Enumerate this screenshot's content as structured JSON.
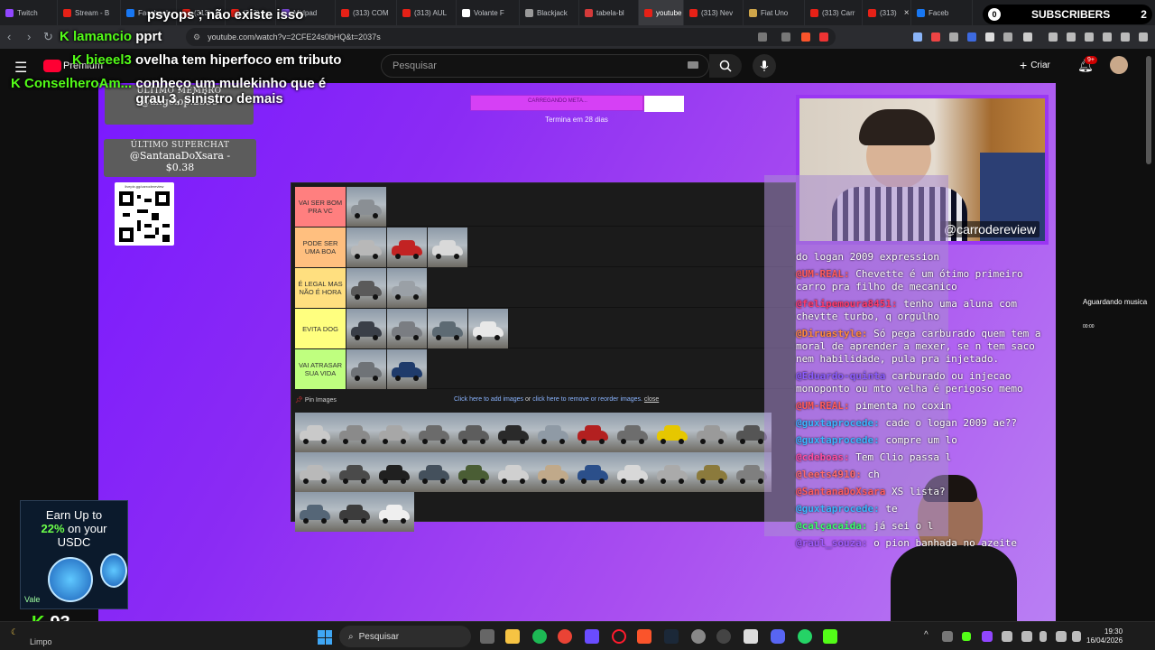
{
  "tabs": [
    {
      "label": "Twitch",
      "color": "#9146ff"
    },
    {
      "label": "Stream - B",
      "color": "#e62117"
    },
    {
      "label": "Facebook",
      "color": "#1877f2"
    },
    {
      "label": "(313) ...",
      "color": "#e62117"
    },
    {
      "label": "(313) ...",
      "color": "#e62117"
    },
    {
      "label": "Midpad",
      "color": "#7b4bd8"
    },
    {
      "label": "(313) COM",
      "color": "#e62117"
    },
    {
      "label": "(313) AUL",
      "color": "#e62117"
    },
    {
      "label": "Volante F",
      "color": "#ffffff"
    },
    {
      "label": "Blackjack",
      "color": "#999999"
    },
    {
      "label": "tabela-bl",
      "color": "#d43a3a"
    },
    {
      "label": "youtube",
      "color": "#e62117"
    },
    {
      "label": "(313) Nev",
      "color": "#e62117"
    },
    {
      "label": "Fiat Uno",
      "color": "#cfa54a"
    },
    {
      "label": "(313) Carr",
      "color": "#e62117"
    },
    {
      "label": "(313)",
      "color": "#e62117"
    },
    {
      "label": "Faceb",
      "color": "#1877f2"
    }
  ],
  "address": {
    "url": "youtube.com/watch?v=2CFE24s0bHQ&t=2037s"
  },
  "youtube": {
    "search_placeholder": "Pesquisar",
    "create_label": "Criar",
    "notif_count": "9+",
    "premium_label": "Premium"
  },
  "overlay": {
    "last_member_title": "ÚLTIMO MEMBRO",
    "last_member_user": "@angelop.2339",
    "last_superchat_title": "ÚLTIMO SUPERCHAT",
    "last_superchat_user": "@SantanaDoXsara -",
    "last_superchat_amount": "$0.38",
    "qr_caption": "livepix.gg/carrodereview",
    "goal_text": "CARREGANDO META...",
    "goal_progress": 0.81,
    "goal_sub": "Termina em 28 dias",
    "cam_tag": "@carrodereview",
    "music_label": "Aguardando musica",
    "music_time": "00:00"
  },
  "tiers": [
    {
      "label": "VAI SER BOM PRA VC",
      "color": "#ff7f7f",
      "cars": [
        "#8a8f94"
      ]
    },
    {
      "label": "PODE SER UMA BOA",
      "color": "#ffbf7f",
      "cars": [
        "#b8b8b8",
        "#c22323",
        "#d9d9d9"
      ]
    },
    {
      "label": "É LEGAL MAS NÃO É HORA",
      "color": "#ffdf7f",
      "cars": [
        "#5a5a5a",
        "#9aa0a6"
      ]
    },
    {
      "label": "EVITA DOG",
      "color": "#ffff7f",
      "cars": [
        "#3a3f48",
        "#7a7d82",
        "#5d6a73",
        "#e8e8e8"
      ]
    },
    {
      "label": "VAI ATRASAR SUA VIDA",
      "color": "#bfff7f",
      "cars": [
        "#6f7377",
        "#1f3b6b"
      ]
    }
  ],
  "pin": {
    "label": "Pin Images",
    "add_link": "Click here to add images",
    "or": "or",
    "remove_link": "click here to remove or reorder images.",
    "close": "close"
  },
  "pool_cars": [
    "#c9c9c9",
    "#8a8a8a",
    "#a7a7a7",
    "#6b6b6b",
    "#5d5d5d",
    "#2a2a2a",
    "#8f9aa5",
    "#b32020",
    "#6d6d6d",
    "#e6c700",
    "#9a9a9a",
    "#555555",
    "#b9b9b9",
    "#4a4a4a",
    "#202020",
    "#44505c",
    "#4a5d34",
    "#d0d0d0",
    "#c0a98a",
    "#2b4f8a",
    "#d8d8d8",
    "#aaaaaa",
    "#8b7a3c",
    "#7f7f7f",
    "#556677",
    "#3c3c3c",
    "#efefef"
  ],
  "chat": [
    {
      "user": "",
      "text": "do logan 2009 expression",
      "color": "#ffffff"
    },
    {
      "user": "@UM-REAL:",
      "text": "Chevette é um ótimo primeiro carro pra filho de mecanico",
      "color": "#ff5c5c"
    },
    {
      "user": "@felipemoura8451:",
      "text": "tenho uma aluna com chevtte turbo, q orgulho",
      "color": "#ff3b6b"
    },
    {
      "user": "@Diruastyle:",
      "text": "Só pega carburado quem tem a moral de aprender a mexer, se n tem saco nem habilidade, pula pra injetado.",
      "color": "#ff8a3b"
    },
    {
      "user": "@Eduardo-quinta",
      "text": "carburado ou injecao monoponto ou mto velha é perigoso memo",
      "color": "#8b5cff"
    },
    {
      "user": "@UM-REAL:",
      "text": "pimenta no coxin",
      "color": "#ff5c5c"
    },
    {
      "user": "@guxtaprocede:",
      "text": "cade o logan 2009 ae??",
      "color": "#3bb6ff"
    },
    {
      "user": "@guxtaprocede:",
      "text": "compre um lo",
      "color": "#3bb6ff"
    },
    {
      "user": "@cdeboas:",
      "text": "Tem Clio passa l",
      "color": "#ff4fa3"
    },
    {
      "user": "@leets4910:",
      "text": "ch",
      "color": "#ff6b6b"
    },
    {
      "user": "@SantanaDoXsara",
      "text": "XS lista?",
      "color": "#ff5c5c"
    },
    {
      "user": "@guxtaprocede:",
      "text": "te",
      "color": "#3bb6ff"
    },
    {
      "user": "@calçacaida:",
      "text": "já sei o l",
      "color": "#3bff6b"
    },
    {
      "user": "@raul_souza:",
      "text": "o pion banhada no azeite",
      "color": "#a05cff"
    }
  ],
  "kick_chat": [
    {
      "user": "",
      "text": "psyops ; não existe isso"
    },
    {
      "user": "lamancio",
      "text": "pprt"
    },
    {
      "user": "bieeel3",
      "text": "ovelha tem hiperfoco em tributo"
    },
    {
      "user": "ConselheroAm...",
      "text": "conheço um mulekinho que é grau 3, sinistro demais"
    }
  ],
  "subscribers": {
    "count_left": "0",
    "label": "SUBSCRIBERS",
    "count_right": "2"
  },
  "ad": {
    "line1": "Earn Up to",
    "pct": "22%",
    "line2": "on your",
    "line3": "USDC",
    "vale": "Vale"
  },
  "kick_counter": "93",
  "weather": "Limpo",
  "taskbar": {
    "search": "Pesquisar"
  },
  "clock": {
    "time": "19:30",
    "date": "16/04/2026"
  }
}
